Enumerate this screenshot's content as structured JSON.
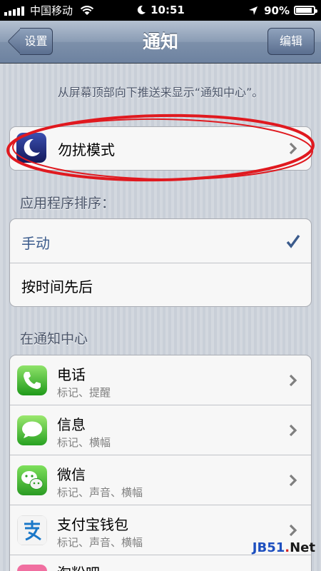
{
  "status_bar": {
    "carrier": "中国移动",
    "time": "10:51",
    "battery": "90%",
    "battery_level": 0.9
  },
  "nav": {
    "back_label": "设置",
    "title": "通知",
    "edit_label": "编辑"
  },
  "hint": "从屏幕顶部向下推送来显示“通知中心”。",
  "dnd": {
    "label": "勿扰模式"
  },
  "sort": {
    "header": "应用程序排序：",
    "options": [
      {
        "label": "手动",
        "selected": true
      },
      {
        "label": "按时间先后",
        "selected": false
      }
    ]
  },
  "center": {
    "header": "在通知中心",
    "apps": [
      {
        "name": "电话",
        "detail": "标记、提醒",
        "icon": "phone-icon"
      },
      {
        "name": "信息",
        "detail": "标记、横幅",
        "icon": "messages-icon"
      },
      {
        "name": "微信",
        "detail": "标记、声音、横幅",
        "icon": "wechat-icon"
      },
      {
        "name": "支付宝钱包",
        "detail": "标记、声音、横幅",
        "icon": "alipay-icon"
      },
      {
        "name": "淘粉吧",
        "detail": "",
        "icon": "taofenba-icon"
      }
    ]
  },
  "watermark": {
    "brand": "JB51",
    "dot": ".",
    "suffix": "Net"
  },
  "colors": {
    "accent_check": "#3b5b8c",
    "annotation": "#e0191f",
    "selected_text": "#3b5b8c"
  }
}
